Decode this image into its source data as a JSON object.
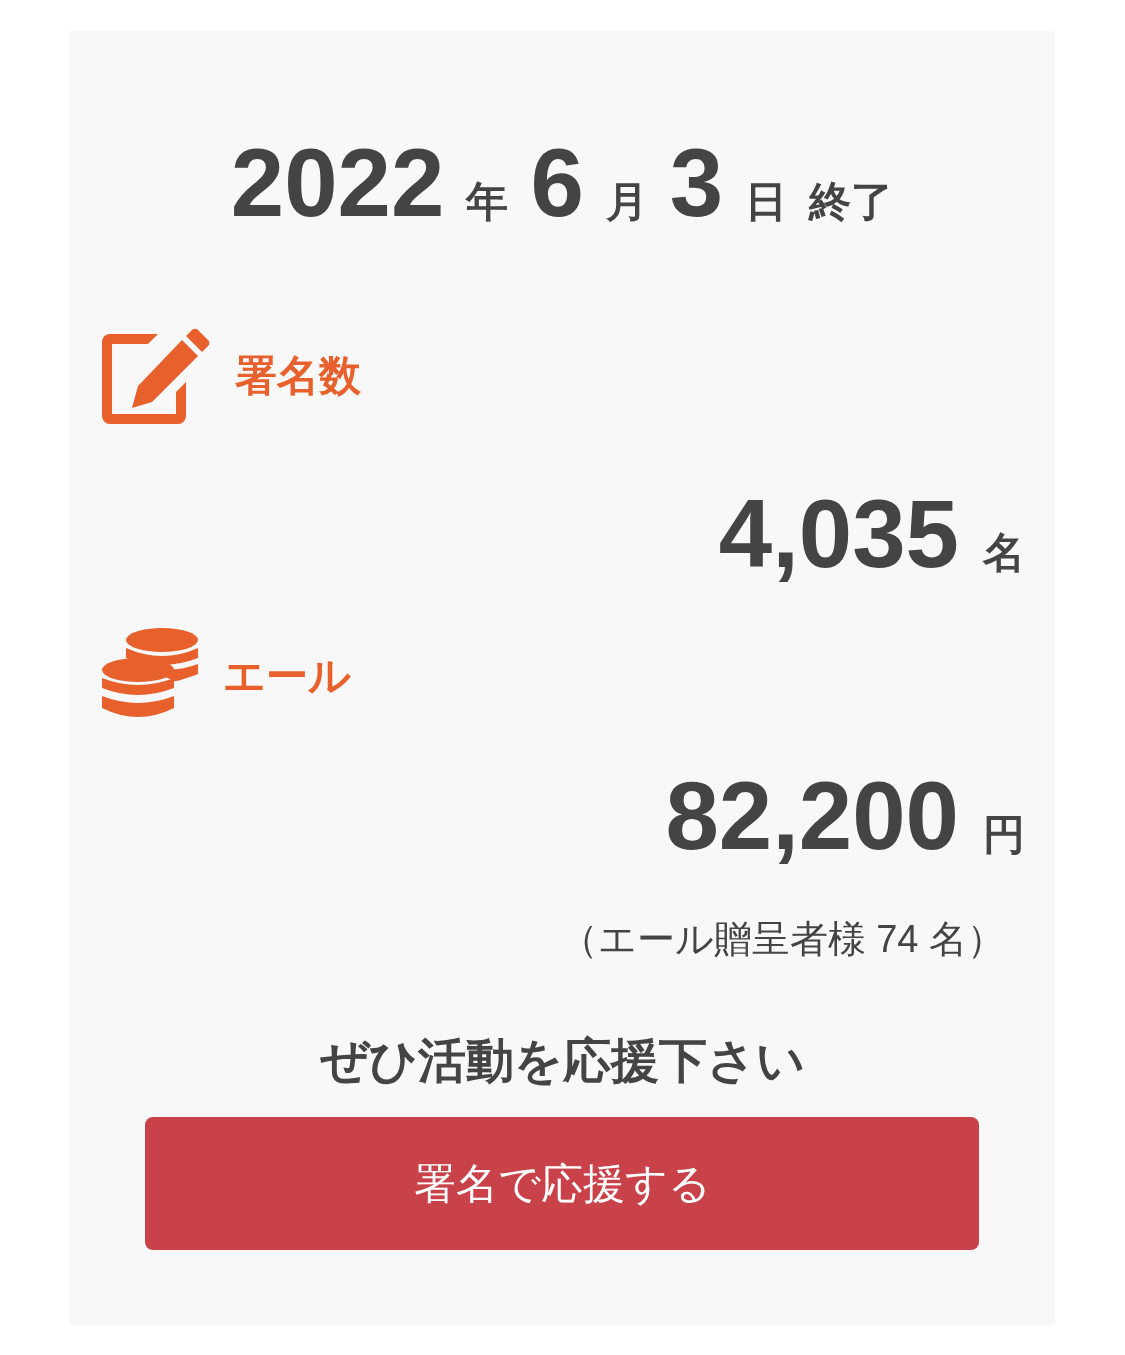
{
  "end_date": {
    "year": "2022",
    "year_unit": "年",
    "month": "6",
    "month_unit": "月",
    "day": "3",
    "day_unit": "日",
    "status": "終了"
  },
  "stats": [
    {
      "kind": "signatures",
      "label": "署名数",
      "value": "4,035",
      "unit": "名"
    },
    {
      "kind": "cheers",
      "label": "エール",
      "value": "82,200",
      "unit": "円",
      "note": "（エール贈呈者様 74 名）"
    }
  ],
  "call_to_action": "ぜひ活動を応援下さい",
  "button": "署名で応援する"
}
